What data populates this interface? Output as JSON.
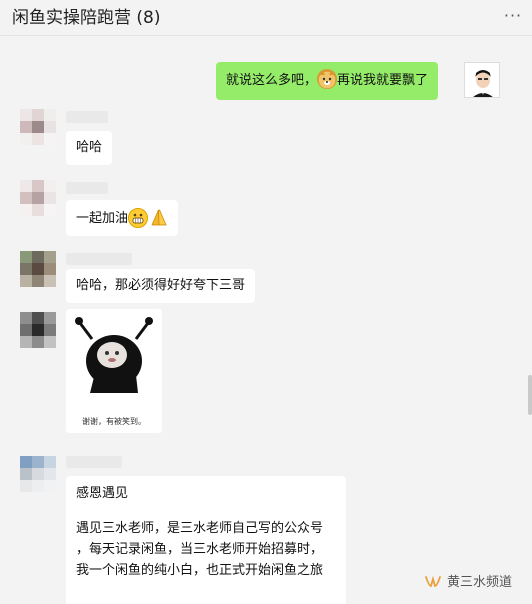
{
  "window": {
    "title": "闲鱼实操陪跑营 (8)",
    "more_icon": "more-dots-icon"
  },
  "messages": {
    "m1": {
      "sender": "me",
      "before": "就说这么多吧，",
      "emoji": "doge-emoji",
      "after": "再说我就要飘了"
    },
    "m2": {
      "text": "哈哈"
    },
    "m3": {
      "text": "一起加油",
      "emojis": [
        "grin-emoji",
        "pray-hands-emoji"
      ]
    },
    "m4": {
      "text": "哈哈，那必须得好好夸下三哥"
    },
    "m5": {
      "sticker_caption": "谢谢，有被笑到。"
    },
    "m6": {
      "line1": "感恩遇见",
      "line2": "遇见三水老师，是三水老师自己写的公众号",
      "line3": "，每天记录闲鱼，当三水老师开始招募时，",
      "line4": "我一个闲鱼的纯小白，也正式开始闲鱼之旅"
    }
  },
  "watermark": {
    "text": "黄三水频道",
    "icon": "wechat-channel-icon"
  },
  "colors": {
    "outgoing_bubble": "#95ec69",
    "incoming_bubble": "#ffffff",
    "background": "#f3f3f3"
  }
}
